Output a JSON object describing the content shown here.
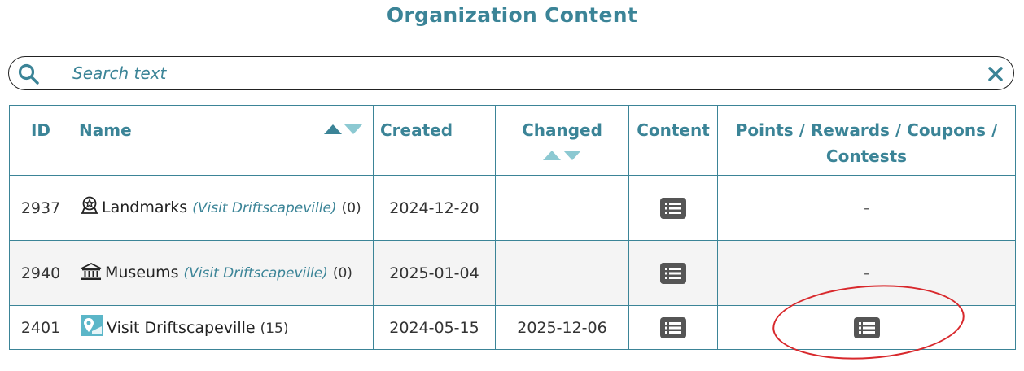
{
  "page": {
    "title": "Organization Content"
  },
  "search": {
    "placeholder": "Search text",
    "value": ""
  },
  "table": {
    "headers": {
      "id": "ID",
      "name": "Name",
      "created": "Created",
      "changed": "Changed",
      "content": "Content",
      "points": "Points / Rewards / Coupons / Contests"
    },
    "rows": [
      {
        "id": "2937",
        "icon": "landmark-badge-icon",
        "name": "Landmarks",
        "visit": "(Visit Driftscapeville)",
        "count": "(0)",
        "created": "2024-12-20",
        "changed": "",
        "content_icon": "list-icon",
        "points": "-"
      },
      {
        "id": "2940",
        "icon": "museum-icon",
        "name": "Museums",
        "visit": "(Visit Driftscapeville)",
        "count": "(0)",
        "created": "2025-01-04",
        "changed": "",
        "content_icon": "list-icon",
        "points": "-"
      },
      {
        "id": "2401",
        "icon": "map-pin-logo-icon",
        "name": "Visit Driftscapeville",
        "visit": "",
        "count": "(15)",
        "created": "2024-05-15",
        "changed": "2025-12-06",
        "content_icon": "list-icon",
        "points_icon": "list-icon"
      }
    ]
  },
  "colors": {
    "accent": "#3b8497",
    "sort_active": "#3b8497",
    "sort_inactive": "#8cc9d2",
    "annotation": "#d8282c",
    "row_alt": "#f4f4f4"
  }
}
